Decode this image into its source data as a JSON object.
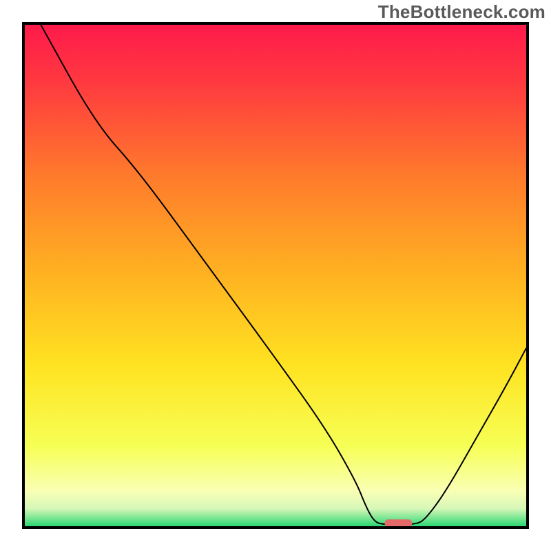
{
  "watermark": "TheBottleneck.com",
  "chart_data": {
    "type": "line",
    "title": "",
    "xlabel": "",
    "ylabel": "",
    "xlim": [
      0,
      100
    ],
    "ylim": [
      0,
      100
    ],
    "grid": false,
    "legend": false,
    "gradient": {
      "description": "vertical red-to-green background",
      "stops": [
        {
          "offset": 0.0,
          "color": "#ff1a4b"
        },
        {
          "offset": 0.12,
          "color": "#ff3b3f"
        },
        {
          "offset": 0.3,
          "color": "#ff7a2c"
        },
        {
          "offset": 0.5,
          "color": "#ffb321"
        },
        {
          "offset": 0.68,
          "color": "#ffe321"
        },
        {
          "offset": 0.84,
          "color": "#f6ff55"
        },
        {
          "offset": 0.93,
          "color": "#f9ffb4"
        },
        {
          "offset": 0.965,
          "color": "#d6f7b8"
        },
        {
          "offset": 1.0,
          "color": "#2bd873"
        }
      ]
    },
    "series": [
      {
        "name": "bottleneck-curve",
        "color": "#000000",
        "stroke_width": 2,
        "points": [
          {
            "x": 3.2,
            "y": 100.0
          },
          {
            "x": 14.0,
            "y": 80.5
          },
          {
            "x": 22.5,
            "y": 71.0
          },
          {
            "x": 35.0,
            "y": 54.0
          },
          {
            "x": 50.0,
            "y": 33.5
          },
          {
            "x": 60.0,
            "y": 19.5
          },
          {
            "x": 66.0,
            "y": 9.0
          },
          {
            "x": 68.0,
            "y": 4.0
          },
          {
            "x": 69.5,
            "y": 1.2
          },
          {
            "x": 71.0,
            "y": 0.3
          },
          {
            "x": 78.0,
            "y": 0.3
          },
          {
            "x": 80.0,
            "y": 1.5
          },
          {
            "x": 84.0,
            "y": 7.0
          },
          {
            "x": 90.0,
            "y": 17.5
          },
          {
            "x": 96.0,
            "y": 28.0
          },
          {
            "x": 100.0,
            "y": 35.5
          }
        ]
      }
    ],
    "marker": {
      "description": "rounded red capsule at curve minimum",
      "x": 74.5,
      "y": 0.6,
      "width_pct": 5.5,
      "height_pct": 1.5,
      "fill": "#e46a6a",
      "rx_pct": 0.75
    },
    "frame": {
      "color": "#000000",
      "width": 4
    }
  }
}
